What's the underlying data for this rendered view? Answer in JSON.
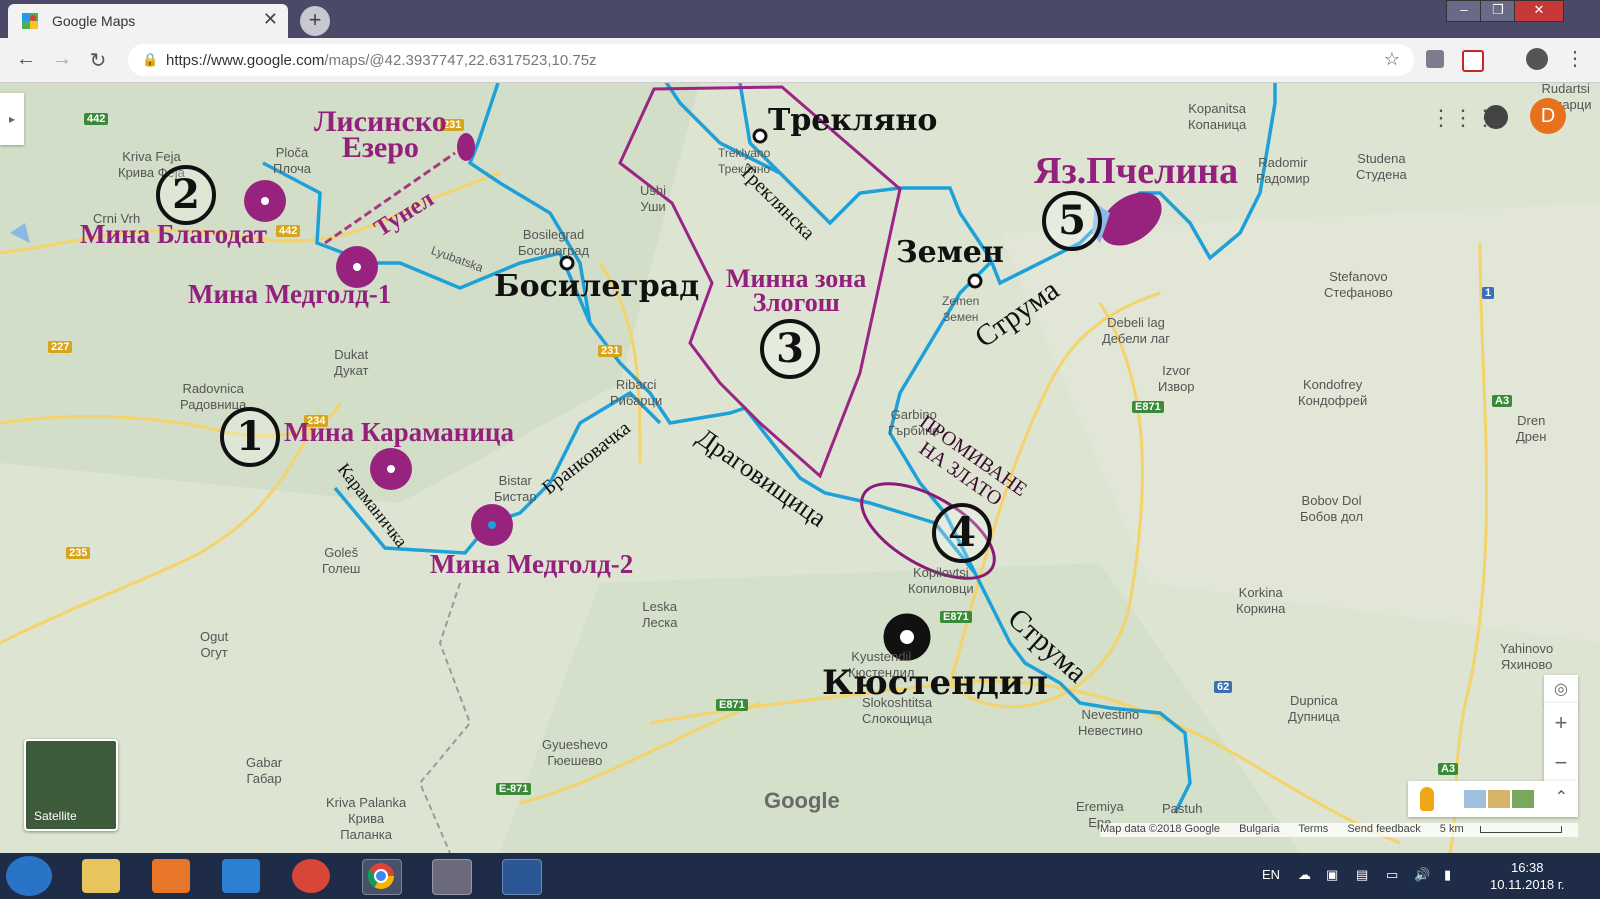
{
  "browser": {
    "tab_title": "Google Maps",
    "tab_close": "✕",
    "new_tab": "+",
    "url_host": "https://www.google.com",
    "url_path": "/maps/@42.3937747,22.6317523,10.75z",
    "min": "–",
    "max": "❐",
    "close": "✕"
  },
  "map": {
    "avatar_letter": "D",
    "satellite_label": "Satellite",
    "google_logo": "Google",
    "zoom_in": "+",
    "zoom_out": "−",
    "footer": {
      "data": "Map data ©2018 Google",
      "country": "Bulgaria",
      "terms": "Terms",
      "feedback": "Send feedback",
      "scale": "5 km"
    },
    "places": [
      {
        "id": "kriva-feja",
        "text": "Kriva Feja\nКрива Феја"
      },
      {
        "id": "ploca",
        "text": "Ploča\nПлоча"
      },
      {
        "id": "crni-vrh",
        "text": "Crni Vrh"
      },
      {
        "id": "bosilegrad-small",
        "text": "Bosilegrad\nБосилеград"
      },
      {
        "id": "dukat",
        "text": "Dukat\nДукат"
      },
      {
        "id": "radovnica",
        "text": "Radovnica\nРадовница"
      },
      {
        "id": "ribarci",
        "text": "Ribarci\nРибарци"
      },
      {
        "id": "bistar",
        "text": "Bistar\nБистар"
      },
      {
        "id": "goles",
        "text": "Goleš\nГолеш"
      },
      {
        "id": "ushi",
        "text": "Ushi\nУши"
      },
      {
        "id": "treklyano-small",
        "text": "Treklyano\nТрекляно"
      },
      {
        "id": "zemen-small",
        "text": "Zemen\nЗемен"
      },
      {
        "id": "garbino",
        "text": "Garbino\nГърбино"
      },
      {
        "id": "koprivshtitsa",
        "text": "Kopilovtsi\nКопиловци"
      },
      {
        "id": "kyus",
        "text": "Kyustendil\nКюстендил"
      },
      {
        "id": "slokoshtitsa",
        "text": "Slokoshtitsa\nСлокощица"
      },
      {
        "id": "leska",
        "text": "Leska\nЛеска"
      },
      {
        "id": "ogut",
        "text": "Ogut\nОгут"
      },
      {
        "id": "gyueshevo",
        "text": "Gyueshevo\nГюешево"
      },
      {
        "id": "gabar",
        "text": "Gabar\nГабар"
      },
      {
        "id": "kriva-palanka",
        "text": "Kriva Palanka\nКрива\nПаланка"
      },
      {
        "id": "koprivnitsa",
        "text": "Kopanitsa\nКопаница"
      },
      {
        "id": "radomir",
        "text": "Radomir\nРадомир"
      },
      {
        "id": "studena",
        "text": "Studena\nСтудена"
      },
      {
        "id": "rudartsi",
        "text": "Rudartsi\nРударци"
      },
      {
        "id": "stefanovo",
        "text": "Stefanovo\nСтефаново"
      },
      {
        "id": "debeli-lag",
        "text": "Debeli lag\nДебели лаг"
      },
      {
        "id": "izvor",
        "text": "Izvor\nИзвор"
      },
      {
        "id": "kondofrey",
        "text": "Kondofrey\nКондофрей"
      },
      {
        "id": "dren",
        "text": "Dren\nДрен"
      },
      {
        "id": "bobov-dol",
        "text": "Bobov Dol\nБобов дол"
      },
      {
        "id": "korkina",
        "text": "Korkina\nКоркина"
      },
      {
        "id": "yahinovo",
        "text": "Yahinovo\nЯхиново"
      },
      {
        "id": "dupnica",
        "text": "Dupnica\nДупница"
      },
      {
        "id": "nevestino",
        "text": "Nevestino\nНевестино"
      },
      {
        "id": "eremiya",
        "text": "Eremiya\nЕре"
      },
      {
        "id": "pastuh",
        "text": "Pastuh"
      },
      {
        "id": "lyubatska",
        "text": "Lyubatska"
      }
    ],
    "roads": {
      "r442a": "442",
      "r442b": "442",
      "r227": "227",
      "r231a": "231",
      "r231b": "231",
      "r235": "235",
      "r234": "234",
      "e871a": "E871",
      "e871b": "E871",
      "e871c": "E871",
      "e871d": "E-871",
      "r62": "62",
      "a3a": "A3",
      "a3b": "A3",
      "r1": "1"
    },
    "annotations": {
      "treklyano": "Трекляно",
      "zemen": "Земен",
      "bosilegrad": "Босилеград",
      "kyustendil": "Кюстендил",
      "lisinsko": "Лисинско\nЕзеро",
      "pchelina": "Яз.Пчелина",
      "blagodat": "Мина Благодат",
      "medgold1": "Мина Медголд-1",
      "karamanica": "Мина Караманица",
      "medgold2": "Мина Медголд-2",
      "zlogosh": "Минна зона\nЗлогош",
      "tunel": "Тунел",
      "trekljanska": "Треклянска",
      "struma1": "Струма",
      "struma2": "Струма",
      "dragovishtica": "Драговищица",
      "brankovachka": "Бранковачка",
      "karamanichka": "Караманичка",
      "promivane": "ПРОМИВАНЕ\nНА ЗЛАТО",
      "n1": "1",
      "n2": "2",
      "n3": "3",
      "n4": "4",
      "n5": "5"
    }
  },
  "taskbar": {
    "lang": "EN",
    "time": "16:38",
    "date": "10.11.2018 г."
  }
}
